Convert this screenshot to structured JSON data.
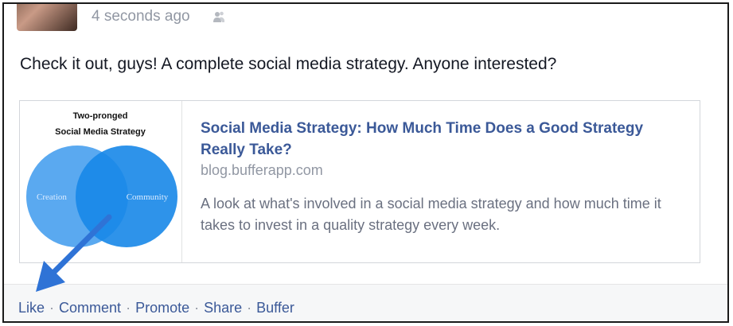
{
  "post": {
    "timestamp": "4 seconds ago",
    "audience_icon": "friends-icon",
    "text": "Check it out, guys! A complete social media strategy. Anyone interested?"
  },
  "link_card": {
    "thumbnail": {
      "title_line1": "Two-pronged",
      "title_line2": "Social Media Strategy",
      "left_circle_label": "Creation",
      "right_circle_label": "Community"
    },
    "title": "Social Media Strategy: How Much Time Does a Good Strategy Really Take?",
    "domain": "blog.bufferapp.com",
    "description": "A look at what's involved in a social media strategy and how much time it takes to invest in a quality strategy every week."
  },
  "actions": {
    "like": "Like",
    "comment": "Comment",
    "promote": "Promote",
    "share": "Share",
    "buffer": "Buffer",
    "separator": "·"
  },
  "colors": {
    "link_blue": "#3b5998",
    "muted_gray": "#9197a3",
    "circle_left": "#5aa9f0",
    "circle_right": "#1787e8",
    "arrow_blue": "#2f73d6"
  }
}
